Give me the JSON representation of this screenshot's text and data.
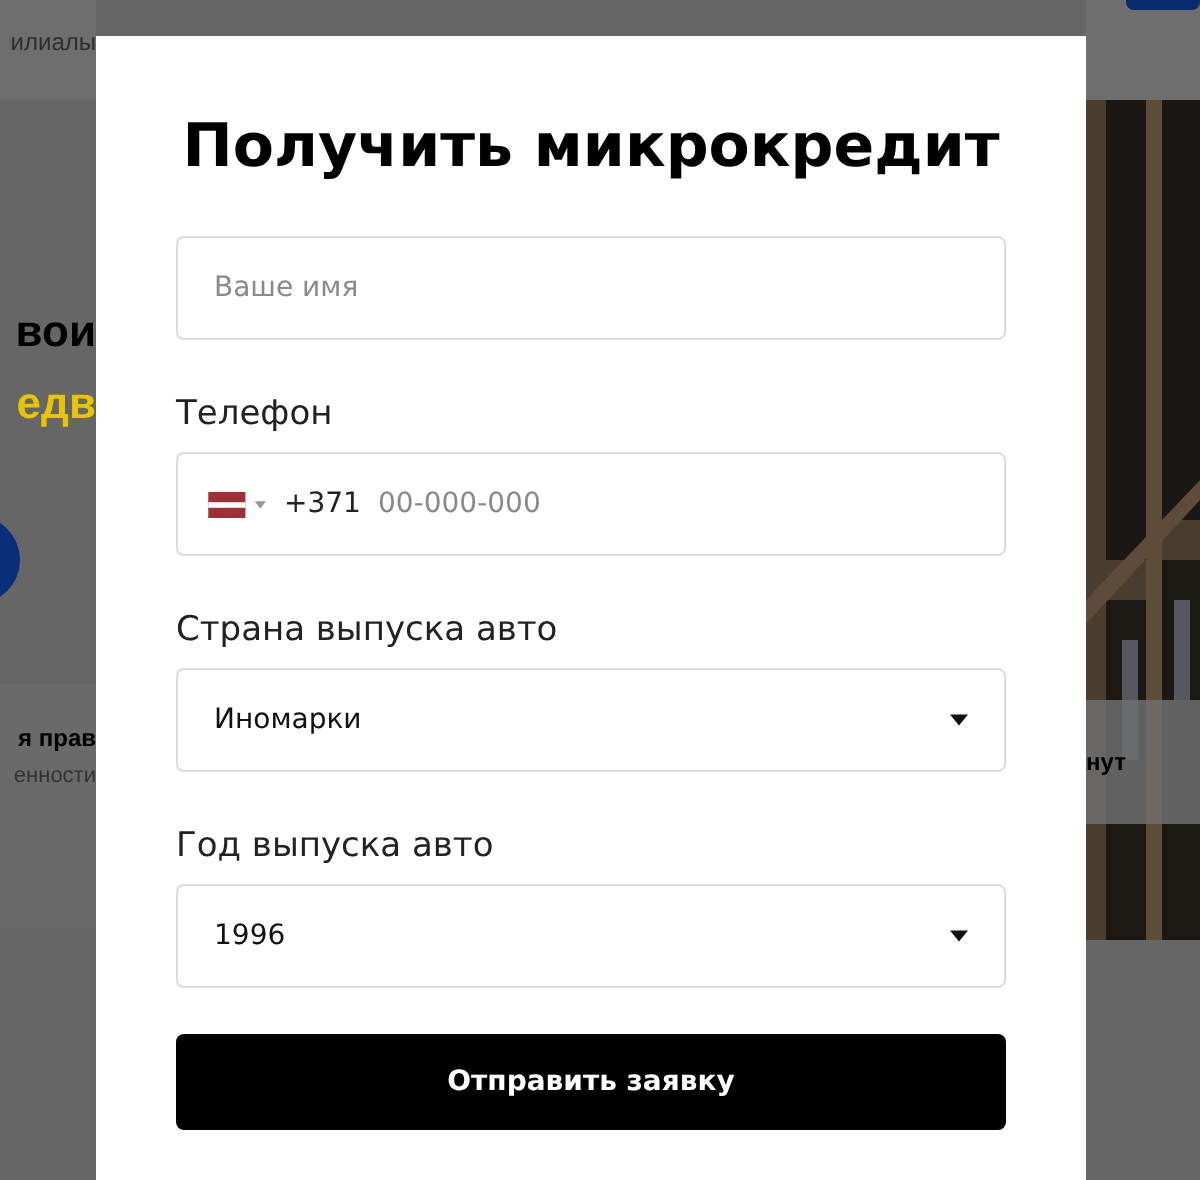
{
  "background": {
    "nav_text": "илиалы",
    "headline": "вои",
    "headline_accent": "едв",
    "feature_title": "я прав",
    "feature_text": "енности",
    "right_text": "нут"
  },
  "modal": {
    "title": "Получить микрокредит",
    "fields": [
      {
        "kind": "text",
        "placeholder": "Ваше имя"
      },
      {
        "kind": "phone",
        "label": "Телефон",
        "prefix": "+371",
        "placeholder": "00-000-000"
      },
      {
        "kind": "select",
        "label": "Страна выпуска авто",
        "value": "Иномарки"
      },
      {
        "kind": "select",
        "label": "Год выпуска авто",
        "value": "1996"
      }
    ],
    "submit": "Отправить заявку"
  }
}
